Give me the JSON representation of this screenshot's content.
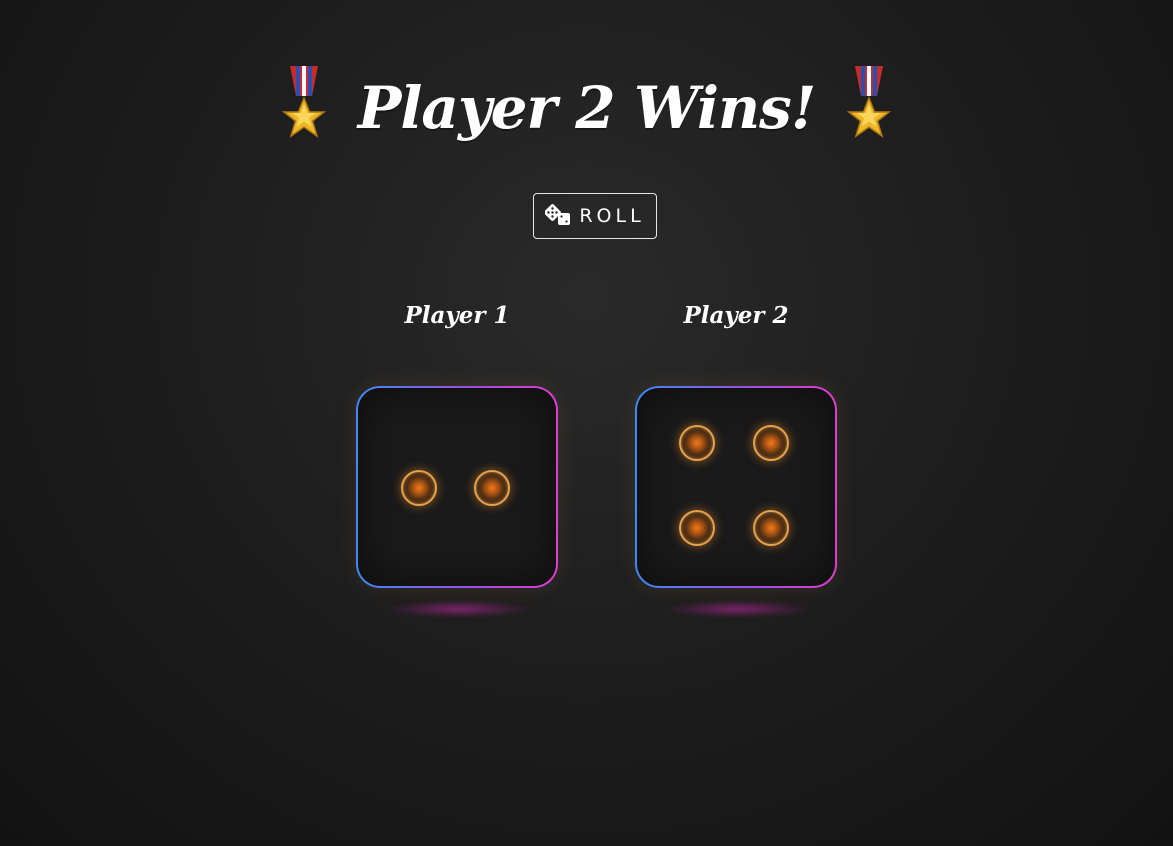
{
  "header": {
    "title": "Player 2 Wins!",
    "left_icon": "military-medal-icon",
    "right_icon": "military-medal-icon"
  },
  "controls": {
    "roll_label": "ROLL",
    "roll_icon": "dice-icon"
  },
  "players": [
    {
      "name": "Player 1",
      "die_value": 2
    },
    {
      "name": "Player 2",
      "die_value": 4
    }
  ],
  "colors": {
    "die_border_start": "#3d8bf5",
    "die_border_end": "#e13bd0",
    "pip": "#e8a24a",
    "background": "#1e1e1e"
  }
}
